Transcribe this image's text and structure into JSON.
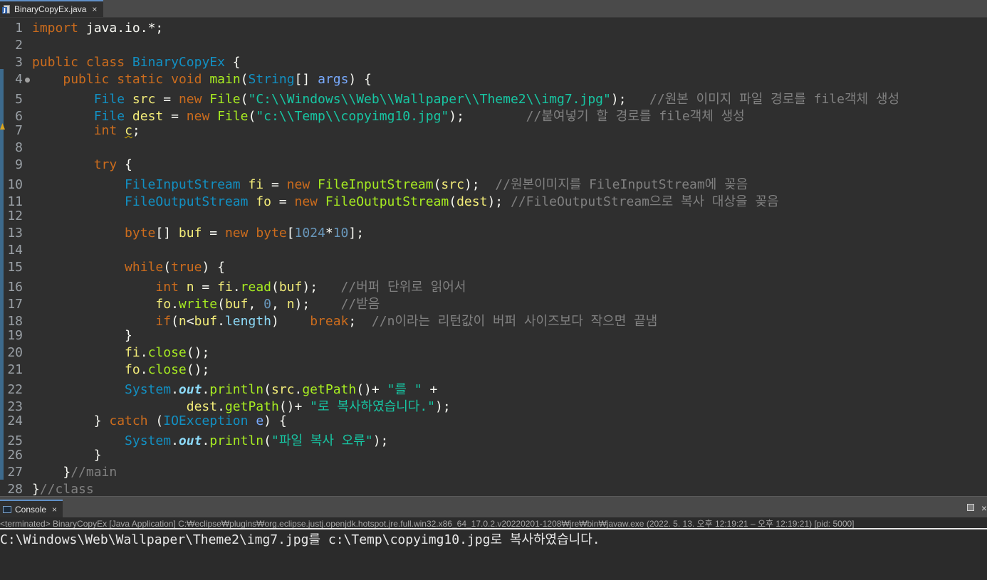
{
  "editor_tab": {
    "label": "BinaryCopyEx.java",
    "close": "×"
  },
  "code_lines": [
    {
      "n": "1",
      "parts": [
        [
          "kw",
          "import"
        ],
        [
          "df",
          " java.io.*;"
        ]
      ]
    },
    {
      "n": "2",
      "parts": []
    },
    {
      "n": "3",
      "parts": [
        [
          "kw",
          "public"
        ],
        [
          "df",
          " "
        ],
        [
          "kw",
          "class"
        ],
        [
          "df",
          " "
        ],
        [
          "ty",
          "BinaryCopyEx"
        ],
        [
          "df",
          " {"
        ]
      ]
    },
    {
      "n": "4",
      "fold": true,
      "parts": [
        [
          "df",
          "    "
        ],
        [
          "kw",
          "public"
        ],
        [
          "df",
          " "
        ],
        [
          "kw",
          "static"
        ],
        [
          "df",
          " "
        ],
        [
          "kw",
          "void"
        ],
        [
          "df",
          " "
        ],
        [
          "fn",
          "main"
        ],
        [
          "df",
          "("
        ],
        [
          "ty",
          "String"
        ],
        [
          "df",
          "[] "
        ],
        [
          "ar",
          "args"
        ],
        [
          "df",
          ") {"
        ]
      ]
    },
    {
      "n": "5",
      "parts": [
        [
          "df",
          "        "
        ],
        [
          "ty",
          "File"
        ],
        [
          "df",
          " "
        ],
        [
          "vr",
          "src"
        ],
        [
          "df",
          " = "
        ],
        [
          "kw",
          "new"
        ],
        [
          "df",
          " "
        ],
        [
          "fn",
          "File"
        ],
        [
          "df",
          "("
        ],
        [
          "st",
          "\"C:\\\\Windows\\\\Web\\\\Wallpaper\\\\Theme2\\\\img7.jpg\""
        ],
        [
          "df",
          ");   "
        ],
        [
          "cm",
          "//원본 이미지 파일 경로를 file객체 생성"
        ]
      ]
    },
    {
      "n": "6",
      "parts": [
        [
          "df",
          "        "
        ],
        [
          "ty",
          "File"
        ],
        [
          "df",
          " "
        ],
        [
          "vr",
          "dest"
        ],
        [
          "df",
          " = "
        ],
        [
          "kw",
          "new"
        ],
        [
          "df",
          " "
        ],
        [
          "fn",
          "File"
        ],
        [
          "df",
          "("
        ],
        [
          "st",
          "\"c:\\\\Temp\\\\copyimg10.jpg\""
        ],
        [
          "df",
          ");        "
        ],
        [
          "cm",
          "//붙여넣기 할 경로를 file객체 생성"
        ]
      ]
    },
    {
      "n": "7",
      "parts": [
        [
          "df",
          "        "
        ],
        [
          "kw",
          "int"
        ],
        [
          "df",
          " "
        ],
        [
          "vr ul",
          "c"
        ],
        [
          "df",
          ";"
        ]
      ]
    },
    {
      "n": "8",
      "parts": []
    },
    {
      "n": "9",
      "parts": [
        [
          "df",
          "        "
        ],
        [
          "kw",
          "try"
        ],
        [
          "df",
          " {"
        ]
      ]
    },
    {
      "n": "10",
      "parts": [
        [
          "df",
          "            "
        ],
        [
          "ty",
          "FileInputStream"
        ],
        [
          "df",
          " "
        ],
        [
          "vr",
          "fi"
        ],
        [
          "df",
          " = "
        ],
        [
          "kw",
          "new"
        ],
        [
          "df",
          " "
        ],
        [
          "fn",
          "FileInputStream"
        ],
        [
          "df",
          "("
        ],
        [
          "vr",
          "src"
        ],
        [
          "df",
          ");  "
        ],
        [
          "cm",
          "//원본이미지를 FileInputStream에 꽂음"
        ]
      ]
    },
    {
      "n": "11",
      "parts": [
        [
          "df",
          "            "
        ],
        [
          "ty",
          "FileOutputStream"
        ],
        [
          "df",
          " "
        ],
        [
          "vr",
          "fo"
        ],
        [
          "df",
          " = "
        ],
        [
          "kw",
          "new"
        ],
        [
          "df",
          " "
        ],
        [
          "fn",
          "FileOutputStream"
        ],
        [
          "df",
          "("
        ],
        [
          "vr",
          "dest"
        ],
        [
          "df",
          "); "
        ],
        [
          "cm",
          "//FileOutputStream으로 복사 대상을 꽂음"
        ]
      ]
    },
    {
      "n": "12",
      "parts": []
    },
    {
      "n": "13",
      "parts": [
        [
          "df",
          "            "
        ],
        [
          "kw",
          "byte"
        ],
        [
          "df",
          "[] "
        ],
        [
          "vr",
          "buf"
        ],
        [
          "df",
          " = "
        ],
        [
          "kw",
          "new"
        ],
        [
          "df",
          " "
        ],
        [
          "kw",
          "byte"
        ],
        [
          "df",
          "["
        ],
        [
          "nm",
          "1024"
        ],
        [
          "df",
          "*"
        ],
        [
          "nm",
          "10"
        ],
        [
          "df",
          "];"
        ]
      ]
    },
    {
      "n": "14",
      "parts": []
    },
    {
      "n": "15",
      "parts": [
        [
          "df",
          "            "
        ],
        [
          "kw",
          "while"
        ],
        [
          "df",
          "("
        ],
        [
          "kw",
          "true"
        ],
        [
          "df",
          ") {"
        ]
      ]
    },
    {
      "n": "16",
      "parts": [
        [
          "df",
          "                "
        ],
        [
          "kw",
          "int"
        ],
        [
          "df",
          " "
        ],
        [
          "vr",
          "n"
        ],
        [
          "df",
          " = "
        ],
        [
          "vr",
          "fi"
        ],
        [
          "df",
          "."
        ],
        [
          "fn",
          "read"
        ],
        [
          "df",
          "("
        ],
        [
          "vr",
          "buf"
        ],
        [
          "df",
          ");   "
        ],
        [
          "cm",
          "//버퍼 단위로 읽어서"
        ]
      ]
    },
    {
      "n": "17",
      "parts": [
        [
          "df",
          "                "
        ],
        [
          "vr",
          "fo"
        ],
        [
          "df",
          "."
        ],
        [
          "fn",
          "write"
        ],
        [
          "df",
          "("
        ],
        [
          "vr",
          "buf"
        ],
        [
          "df",
          ", "
        ],
        [
          "nm",
          "0"
        ],
        [
          "df",
          ", "
        ],
        [
          "vr",
          "n"
        ],
        [
          "df",
          ");    "
        ],
        [
          "cm",
          "//받음"
        ]
      ]
    },
    {
      "n": "18",
      "parts": [
        [
          "df",
          "                "
        ],
        [
          "kw",
          "if"
        ],
        [
          "df",
          "("
        ],
        [
          "vr",
          "n"
        ],
        [
          "df",
          "<"
        ],
        [
          "vr",
          "buf"
        ],
        [
          "df",
          "."
        ],
        [
          "sf2",
          "length"
        ],
        [
          "df",
          ")    "
        ],
        [
          "kw",
          "break"
        ],
        [
          "df",
          ";  "
        ],
        [
          "cm",
          "//n이라는 리턴값이 버퍼 사이즈보다 작으면 끝냄"
        ]
      ]
    },
    {
      "n": "19",
      "parts": [
        [
          "df",
          "            }"
        ]
      ]
    },
    {
      "n": "20",
      "parts": [
        [
          "df",
          "            "
        ],
        [
          "vr",
          "fi"
        ],
        [
          "df",
          "."
        ],
        [
          "fn",
          "close"
        ],
        [
          "df",
          "();"
        ]
      ]
    },
    {
      "n": "21",
      "parts": [
        [
          "df",
          "            "
        ],
        [
          "vr",
          "fo"
        ],
        [
          "df",
          "."
        ],
        [
          "fn",
          "close"
        ],
        [
          "df",
          "();"
        ]
      ]
    },
    {
      "n": "22",
      "parts": [
        [
          "df",
          "            "
        ],
        [
          "ty",
          "System"
        ],
        [
          "df",
          "."
        ],
        [
          "sf",
          "out"
        ],
        [
          "df",
          "."
        ],
        [
          "fn",
          "println"
        ],
        [
          "df",
          "("
        ],
        [
          "vr",
          "src"
        ],
        [
          "df",
          "."
        ],
        [
          "fn",
          "getPath"
        ],
        [
          "df",
          "()+ "
        ],
        [
          "st",
          "\"를 \""
        ],
        [
          "df",
          " +"
        ]
      ]
    },
    {
      "n": "23",
      "parts": [
        [
          "df",
          "                    "
        ],
        [
          "vr",
          "dest"
        ],
        [
          "df",
          "."
        ],
        [
          "fn",
          "getPath"
        ],
        [
          "df",
          "()+ "
        ],
        [
          "st",
          "\"로 복사하였습니다.\""
        ],
        [
          "df",
          ");"
        ]
      ]
    },
    {
      "n": "24",
      "parts": [
        [
          "df",
          "        } "
        ],
        [
          "kw",
          "catch"
        ],
        [
          "df",
          " ("
        ],
        [
          "ty",
          "IOException"
        ],
        [
          "df",
          " "
        ],
        [
          "ar",
          "e"
        ],
        [
          "df",
          ") {"
        ]
      ]
    },
    {
      "n": "25",
      "parts": [
        [
          "df",
          "            "
        ],
        [
          "ty",
          "System"
        ],
        [
          "df",
          "."
        ],
        [
          "sf",
          "out"
        ],
        [
          "df",
          "."
        ],
        [
          "fn",
          "println"
        ],
        [
          "df",
          "("
        ],
        [
          "st",
          "\"파일 복사 오류\""
        ],
        [
          "df",
          ");"
        ]
      ]
    },
    {
      "n": "26",
      "parts": [
        [
          "df",
          "        }"
        ]
      ]
    },
    {
      "n": "27",
      "parts": [
        [
          "df",
          "    }"
        ],
        [
          "cm",
          "//main"
        ]
      ]
    },
    {
      "n": "28",
      "parts": [
        [
          "df",
          "}"
        ],
        [
          "cm",
          "//class"
        ]
      ]
    }
  ],
  "console_tab": {
    "label": "Console",
    "close": "×"
  },
  "console": {
    "title": "<terminated> BinaryCopyEx [Java Application] C:₩eclipse₩plugins₩org.eclipse.justj.openjdk.hotspot.jre.full.win32.x86_64_17.0.2.v20220201-1208₩jre₩bin₩javaw.exe  (2022. 5. 13. 오후 12:19:21 – 오후 12:19:21) [pid: 5000]",
    "output": "C:\\Windows\\Web\\Wallpaper\\Theme2\\img7.jpg를 c:\\Temp\\copyimg10.jpg로 복사하였습니다."
  },
  "colors": {
    "keyword": "#cc6c1d",
    "type": "#1290c3",
    "string": "#17c6a3",
    "comment": "#808080",
    "method": "#a7ec21",
    "variable": "#f3ec79"
  }
}
